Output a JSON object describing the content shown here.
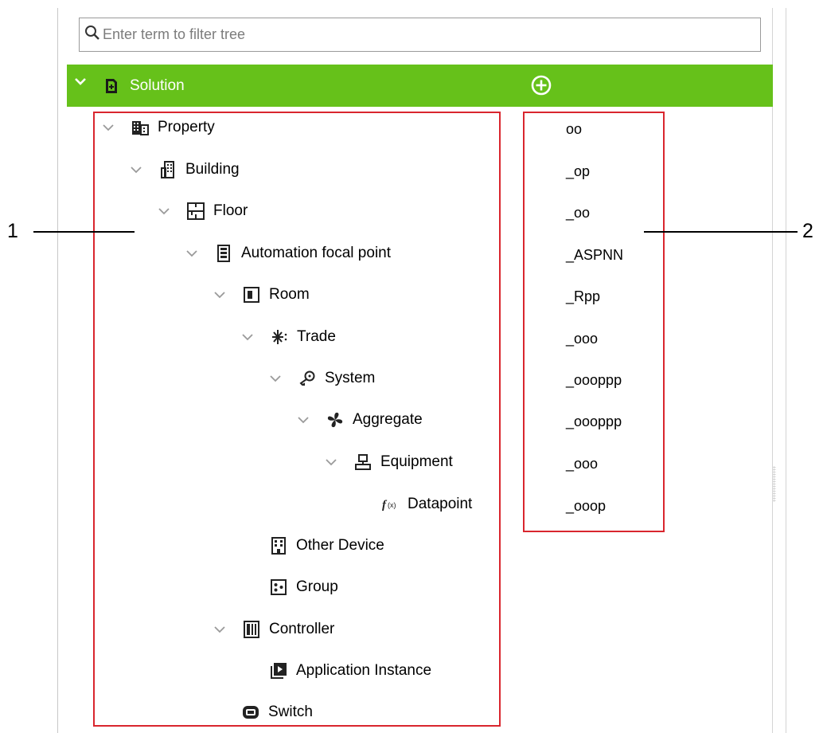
{
  "search": {
    "placeholder": "Enter term to filter tree"
  },
  "root": {
    "label": "Solution"
  },
  "tree": [
    {
      "label": "Property",
      "icon": "property-icon",
      "code": "oo"
    },
    {
      "label": "Building",
      "icon": "building-icon",
      "code": "_op"
    },
    {
      "label": "Floor",
      "icon": "floor-icon",
      "code": "_oo"
    },
    {
      "label": "Automation focal point",
      "icon": "automation-focal-point-icon",
      "code": "_ASPNN"
    },
    {
      "label": "Room",
      "icon": "room-icon",
      "code": "_Rpp"
    },
    {
      "label": "Trade",
      "icon": "trade-icon",
      "code": "_ooo"
    },
    {
      "label": "System",
      "icon": "system-icon",
      "code": "_oooppp"
    },
    {
      "label": "Aggregate",
      "icon": "aggregate-icon",
      "code": "_oooppp"
    },
    {
      "label": "Equipment",
      "icon": "equipment-icon",
      "code": "_ooo"
    },
    {
      "label": "Datapoint",
      "icon": "datapoint-icon",
      "code": "_ooop"
    },
    {
      "label": "Other Device",
      "icon": "other-device-icon"
    },
    {
      "label": "Group",
      "icon": "group-icon"
    },
    {
      "label": "Controller",
      "icon": "controller-icon"
    },
    {
      "label": "Application Instance",
      "icon": "application-instance-icon"
    },
    {
      "label": "Switch",
      "icon": "switch-icon"
    }
  ],
  "callouts": {
    "left": "1",
    "right": "2"
  },
  "colors": {
    "accent_green": "#66c11a",
    "highlight_red": "#d9262e"
  }
}
